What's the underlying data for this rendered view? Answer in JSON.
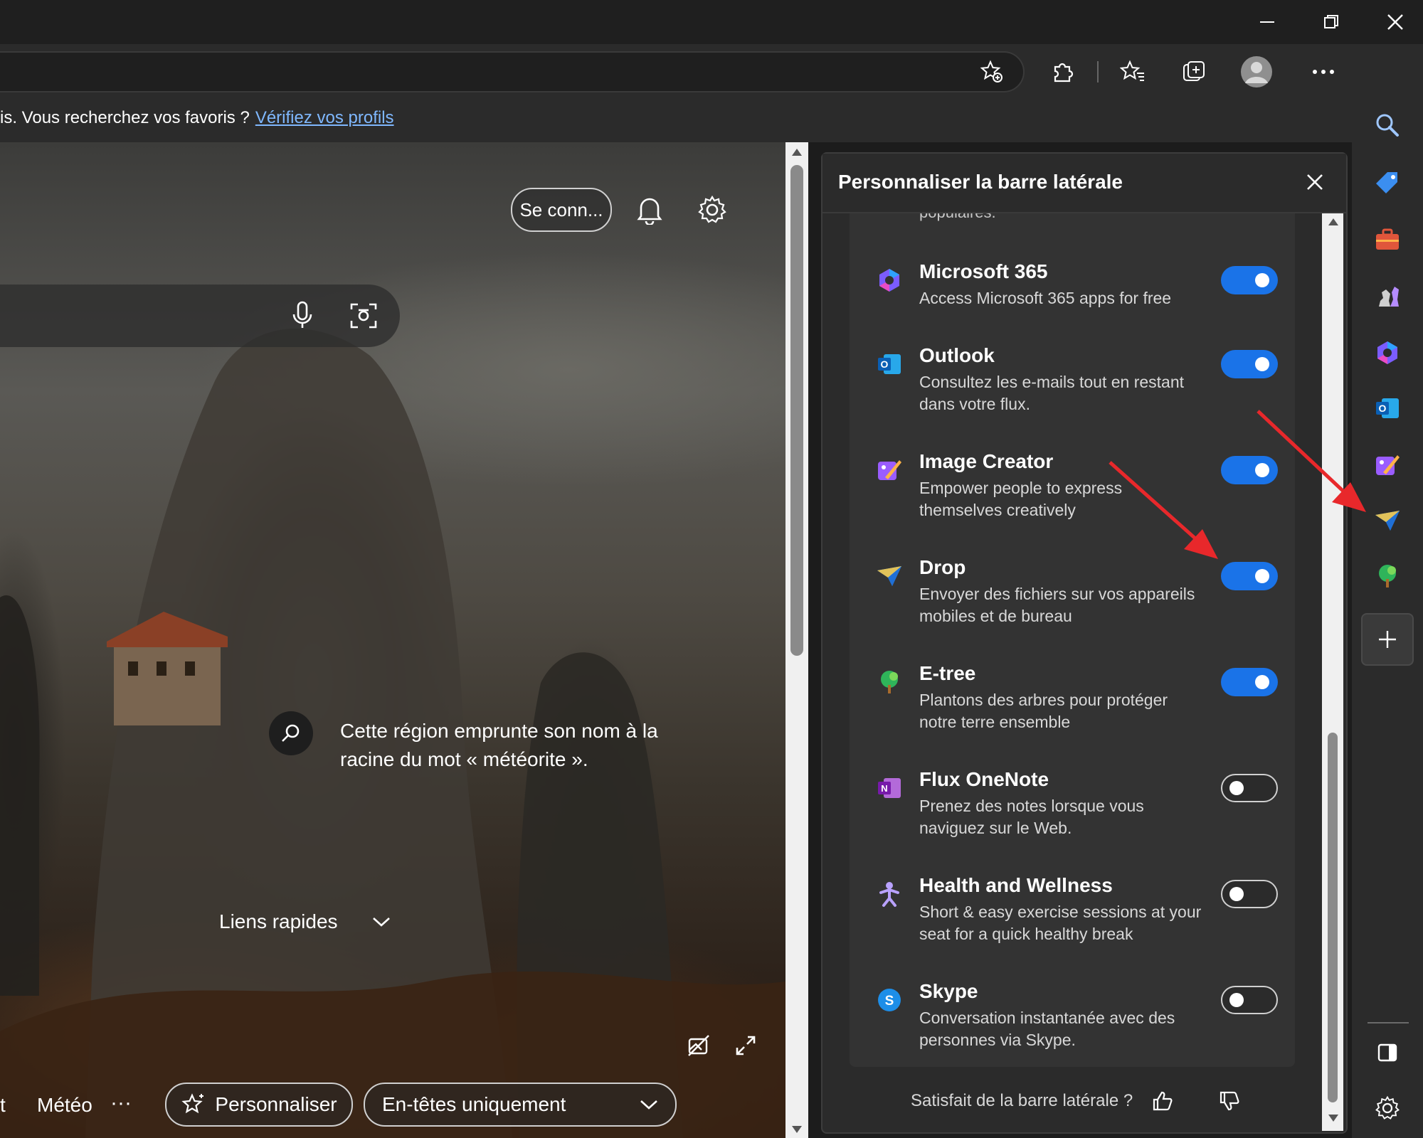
{
  "browser": {
    "window_controls": {
      "minimize": "minimize-icon",
      "maximize": "restore-icon",
      "close": "close-icon"
    },
    "info_bar": {
      "text": "is. Vous recherchez vos favoris ?",
      "link": "Vérifiez vos profils"
    }
  },
  "newtab": {
    "signin_label": "Se conn...",
    "fact_text": "Cette région emprunte son nom à la racine du mot « météorite ».",
    "quick_links_label": "Liens rapides",
    "bottom_cut_label": "t",
    "meteo_label": "Météo",
    "more_label": "···",
    "personalize_label": "Personnaliser",
    "headers_select_value": "En-têtes uniquement"
  },
  "panel": {
    "title": "Personnaliser la barre latérale",
    "cut_text": "populaires.",
    "apps": [
      {
        "name": "Microsoft 365",
        "desc": "Access Microsoft 365 apps for free",
        "enabled": true,
        "icon": "microsoft365-icon"
      },
      {
        "name": "Outlook",
        "desc": "Consultez les e-mails tout en restant dans votre flux.",
        "enabled": true,
        "icon": "outlook-icon"
      },
      {
        "name": "Image Creator",
        "desc": "Empower people to express themselves creatively",
        "enabled": true,
        "icon": "image-creator-icon"
      },
      {
        "name": "Drop",
        "desc": "Envoyer des fichiers sur vos appareils mobiles et de bureau",
        "enabled": true,
        "icon": "drop-icon"
      },
      {
        "name": "E-tree",
        "desc": "Plantons des arbres pour protéger notre terre ensemble",
        "enabled": true,
        "icon": "etree-icon"
      },
      {
        "name": "Flux OneNote",
        "desc": "Prenez des notes lorsque vous naviguez sur le Web.",
        "enabled": false,
        "icon": "onenote-icon"
      },
      {
        "name": "Health and Wellness",
        "desc": "Short & easy exercise sessions at your seat for a quick healthy break",
        "enabled": false,
        "icon": "health-icon"
      },
      {
        "name": "Skype",
        "desc": "Conversation instantanée avec des personnes via Skype.",
        "enabled": false,
        "icon": "skype-icon"
      }
    ],
    "feedback_label": "Satisfait de la barre latérale ?"
  },
  "sidebar": {
    "items": [
      "search-icon",
      "tag-icon",
      "tools-icon",
      "games-icon",
      "microsoft365-icon",
      "outlook-icon",
      "image-creator-icon",
      "drop-icon",
      "etree-icon"
    ],
    "add_label": "+"
  },
  "colors": {
    "accent": "#1a73e8",
    "link": "#7fb8ff",
    "arrow": "#e8282b"
  }
}
